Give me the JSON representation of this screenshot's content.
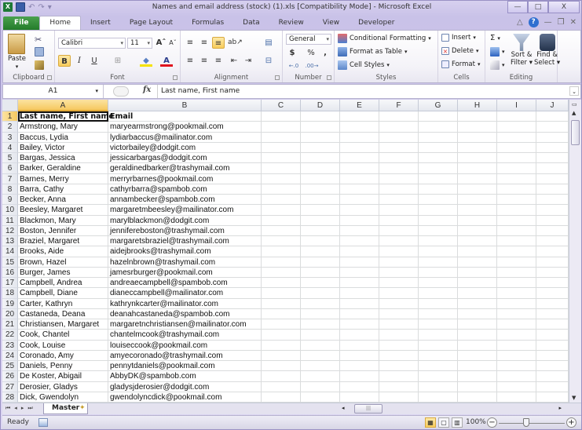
{
  "window": {
    "title": "Names and email address (stock) (1).xls  [Compatibility Mode]  -  Microsoft Excel",
    "app_icon": "X",
    "controls": {
      "minimize": "—",
      "maximize": "□",
      "close": "X"
    }
  },
  "quick_access": {
    "undo": "↶",
    "redo": "↷",
    "customize": "▾"
  },
  "tabs": [
    {
      "label": "File",
      "active": false
    },
    {
      "label": "Home",
      "active": true
    },
    {
      "label": "Insert",
      "active": false
    },
    {
      "label": "Page Layout",
      "active": false
    },
    {
      "label": "Formulas",
      "active": false
    },
    {
      "label": "Data",
      "active": false
    },
    {
      "label": "Review",
      "active": false
    },
    {
      "label": "View",
      "active": false
    },
    {
      "label": "Developer",
      "active": false
    }
  ],
  "tab_right": {
    "collapse": "△",
    "help": "?",
    "min": "—",
    "restore": "❐",
    "close": "✕"
  },
  "ribbon": {
    "clipboard": {
      "label": "Clipboard",
      "paste": "Paste",
      "paste_dd": "▾"
    },
    "font": {
      "label": "Font",
      "font_name": "Calibri",
      "font_size": "11",
      "grow": "Aˆ",
      "shrink": "Aˇ",
      "bold": "B",
      "italic": "I",
      "underline": "U",
      "borders": "⊞",
      "fill": "◆",
      "color": "A"
    },
    "alignment": {
      "label": "Alignment"
    },
    "number": {
      "label": "Number",
      "format": "General",
      "currency": "$",
      "percent": "%",
      "comma": ",",
      "inc_dec": "←.0",
      "dec_dec": ".00→"
    },
    "styles": {
      "label": "Styles",
      "conditional": "Conditional Formatting",
      "format_table": "Format as Table",
      "cell_styles": "Cell Styles"
    },
    "cells": {
      "label": "Cells",
      "insert": "Insert",
      "delete": "Delete",
      "format": "Format"
    },
    "editing": {
      "label": "Editing",
      "autosum": "Σ",
      "sort_filter_1": "Sort &",
      "sort_filter_2": "Filter",
      "find_select_1": "Find &",
      "find_select_2": "Select"
    }
  },
  "formula_bar": {
    "name_box": "A1",
    "fx": "fx",
    "content": "Last name, First name"
  },
  "grid": {
    "columns": [
      "A",
      "B",
      "C",
      "D",
      "E",
      "F",
      "G",
      "H",
      "I",
      "J"
    ],
    "selected_column": "A",
    "rows": [
      {
        "n": "1",
        "a": "Last name, First name",
        "b": "Email"
      },
      {
        "n": "2",
        "a": "Armstrong, Mary",
        "b": "maryearmstrong@pookmail.com"
      },
      {
        "n": "3",
        "a": "Baccus, Lydia",
        "b": "lydiarbaccus@mailinator.com"
      },
      {
        "n": "4",
        "a": "Bailey, Victor",
        "b": "victorbailey@dodgit.com"
      },
      {
        "n": "5",
        "a": "Bargas, Jessica",
        "b": "jessicarbargas@dodgit.com"
      },
      {
        "n": "6",
        "a": "Barker, Geraldine",
        "b": "geraldinedbarker@trashymail.com"
      },
      {
        "n": "7",
        "a": "Barnes, Merry",
        "b": "merryrbarnes@pookmail.com"
      },
      {
        "n": "8",
        "a": "Barra, Cathy",
        "b": "cathyrbarra@spambob.com"
      },
      {
        "n": "9",
        "a": "Becker, Anna",
        "b": "annambecker@spambob.com"
      },
      {
        "n": "10",
        "a": "Beesley, Margaret",
        "b": "margaretmbeesley@mailinator.com"
      },
      {
        "n": "11",
        "a": "Blackmon, Mary",
        "b": "marylblackmon@dodgit.com"
      },
      {
        "n": "12",
        "a": "Boston, Jennifer",
        "b": "jennifereboston@trashymail.com"
      },
      {
        "n": "13",
        "a": "Braziel, Margaret",
        "b": "margaretsbraziel@trashymail.com"
      },
      {
        "n": "14",
        "a": "Brooks, Aide",
        "b": "aidejbrooks@trashymail.com"
      },
      {
        "n": "15",
        "a": "Brown, Hazel",
        "b": "hazelnbrown@trashymail.com"
      },
      {
        "n": "16",
        "a": "Burger, James",
        "b": "jamesrburger@pookmail.com"
      },
      {
        "n": "17",
        "a": "Campbell, Andrea",
        "b": "andreaecampbell@spambob.com"
      },
      {
        "n": "18",
        "a": "Campbell, Diane",
        "b": "dianeccampbell@mailinator.com"
      },
      {
        "n": "19",
        "a": "Carter, Kathryn",
        "b": "kathrynkcarter@mailinator.com"
      },
      {
        "n": "20",
        "a": "Castaneda, Deana",
        "b": "deanahcastaneda@spambob.com"
      },
      {
        "n": "21",
        "a": "Christiansen, Margaret",
        "b": "margaretnchristiansen@mailinator.com"
      },
      {
        "n": "22",
        "a": "Cook, Chantel",
        "b": "chantelmcook@trashymail.com"
      },
      {
        "n": "23",
        "a": "Cook, Louise",
        "b": "louiseccook@pookmail.com"
      },
      {
        "n": "24",
        "a": "Coronado, Amy",
        "b": "amyecoronado@trashymail.com"
      },
      {
        "n": "25",
        "a": "Daniels, Penny",
        "b": "pennytdaniels@pookmail.com"
      },
      {
        "n": "26",
        "a": "De Koster, Abigail",
        "b": "AbbyDK@spambob.com"
      },
      {
        "n": "27",
        "a": "Derosier, Gladys",
        "b": "gladysjderosier@dodgit.com"
      },
      {
        "n": "28",
        "a": "Dick, Gwendolyn",
        "b": "gwendolyncdick@pookmail.com"
      }
    ]
  },
  "sheet_tabs": {
    "nav": "⏮◂▸⏭",
    "active": "Master"
  },
  "status_bar": {
    "mode": "Ready",
    "zoom": "100%",
    "zoom_out": "−",
    "zoom_in": "+"
  }
}
